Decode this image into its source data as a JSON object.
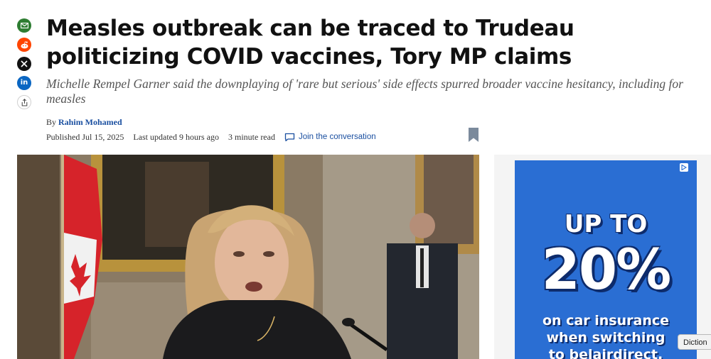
{
  "share": {
    "items": [
      {
        "name": "email",
        "icon": "envelope-icon",
        "color": "#2e7d32"
      },
      {
        "name": "reddit",
        "icon": "reddit-icon",
        "color": "#ff4500"
      },
      {
        "name": "x",
        "icon": "x-icon",
        "color": "#111111"
      },
      {
        "name": "linkedin",
        "icon": "linkedin-icon",
        "label": "in",
        "color": "#0a66c2"
      },
      {
        "name": "more",
        "icon": "share-icon"
      }
    ]
  },
  "article": {
    "headline": "Measles outbreak can be traced to Trudeau politicizing COVID vaccines, Tory MP claims",
    "deck": "Michelle Rempel Garner said the downplaying of 'rare but serious' side effects spurred broader vaccine hesitancy, including for measles",
    "byline_prefix": "By",
    "author": "Rahim Mohamed",
    "published": "Published Jul 15, 2025",
    "updated": "Last updated 9 hours ago",
    "read_time": "3 minute read",
    "join_label": "Join the conversation"
  },
  "ad": {
    "line1": "UP TO",
    "line2": "20%",
    "body_line1": "on car insurance",
    "body_line2": "when switching",
    "body_line3": "to belairdirect.",
    "background": "#2a6ed3"
  },
  "tooltip": {
    "text": "Diction"
  }
}
